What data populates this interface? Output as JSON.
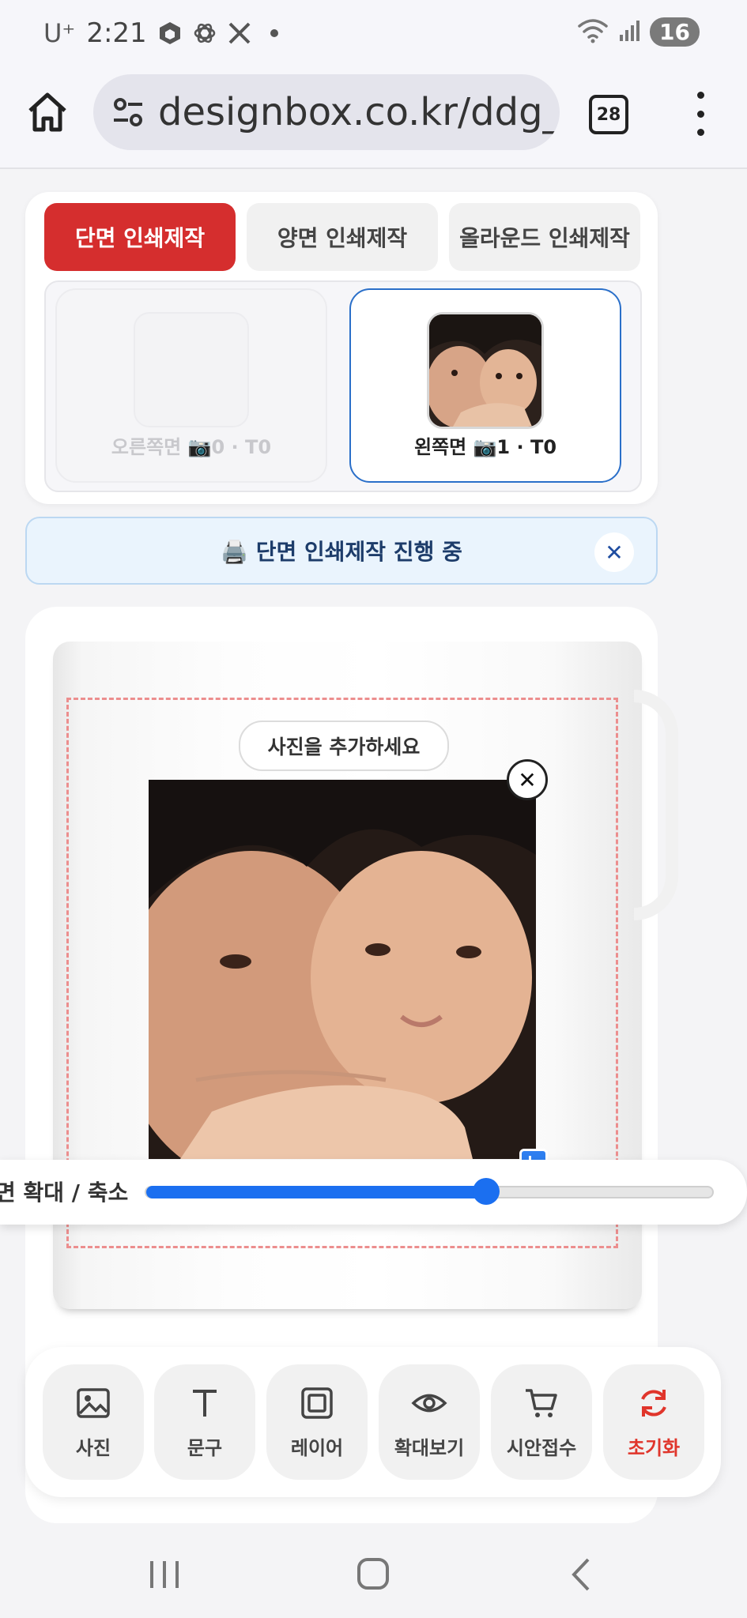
{
  "status_bar": {
    "carrier": "U⁺",
    "time": "2:21",
    "battery": "16",
    "icons": [
      "app-icon",
      "openai-icon",
      "x-icon",
      "wifi-icon",
      "signal-icon"
    ]
  },
  "browser": {
    "url": "designbox.co.kr/ddg_f",
    "tab_count": "28"
  },
  "print_options": {
    "tabs": [
      {
        "label": "단면 인쇄제작",
        "active": true
      },
      {
        "label": "양면 인쇄제작",
        "active": false
      },
      {
        "label": "올라운드 인쇄제작",
        "active": false
      }
    ],
    "sides": [
      {
        "label": "오른쪽면 📷0 · T0",
        "active": false
      },
      {
        "label": "왼쪽면 📷1 · T0",
        "active": true
      }
    ]
  },
  "banner": {
    "text": "🖨️ 단면 인쇄제작 진행 중",
    "close": "✕"
  },
  "editor": {
    "add_photo_hint": "사진을 추가하세요",
    "photo_close": "✕",
    "zoom_label": "면 확대 / 축소",
    "zoom_value": 0.6
  },
  "toolbar": {
    "items": [
      {
        "label": "사진",
        "icon": "image-icon"
      },
      {
        "label": "문구",
        "icon": "text-icon"
      },
      {
        "label": "레이어",
        "icon": "layer-icon"
      },
      {
        "label": "확대보기",
        "icon": "eye-icon"
      },
      {
        "label": "시안접수",
        "icon": "cart-icon"
      },
      {
        "label": "초기화",
        "icon": "refresh-icon"
      }
    ]
  },
  "colors": {
    "accent_red": "#d52e2e",
    "accent_blue": "#1b6ff0",
    "banner_bg": "#eaf4fd"
  }
}
